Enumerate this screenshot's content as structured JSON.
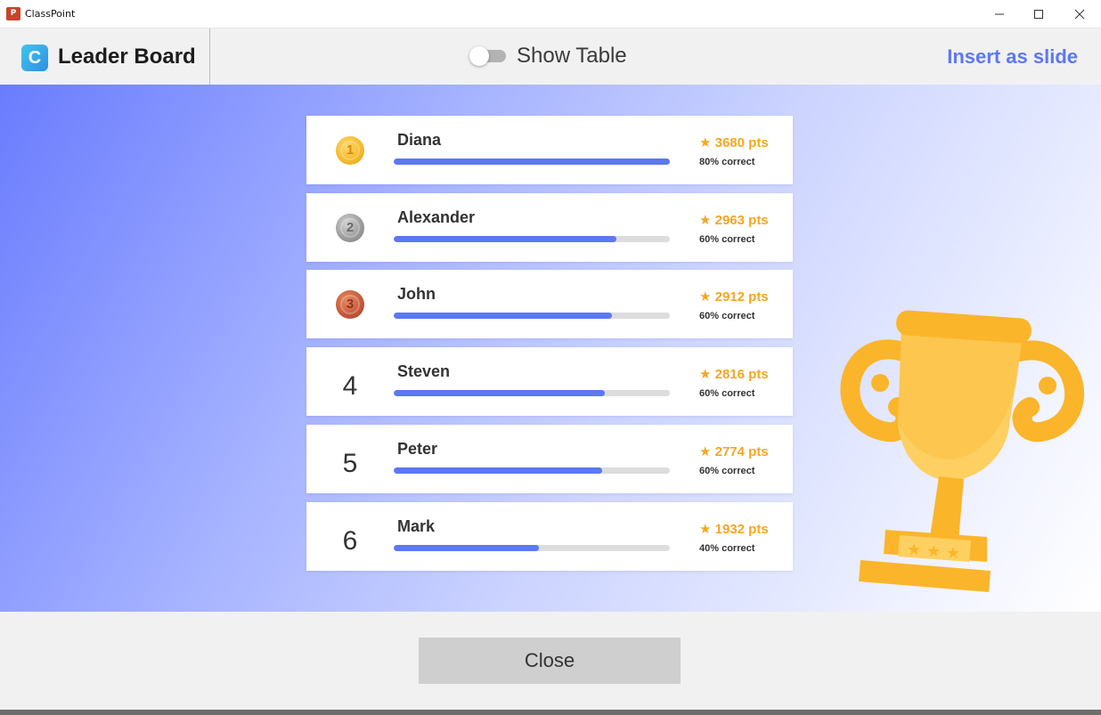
{
  "window": {
    "title": "ClassPoint",
    "app_icon_text": "P",
    "controls": {
      "minimize": "–",
      "maximize": "☐",
      "close": "✕"
    }
  },
  "header": {
    "logo_letter": "C",
    "title": "Leader Board",
    "toggle": {
      "label": "Show Table",
      "on": false
    },
    "insert_label": "Insert as slide"
  },
  "leaderboard": [
    {
      "rank": "1",
      "medal": "gold",
      "name": "Diana",
      "score": "★ 3680 pts",
      "correct": "80% correct",
      "progress": 1.0
    },
    {
      "rank": "2",
      "medal": "silver",
      "name": "Alexander",
      "score": "★ 2963 pts",
      "correct": "60% correct",
      "progress": 0.805
    },
    {
      "rank": "3",
      "medal": "bronze",
      "name": "John",
      "score": "★ 2912 pts",
      "correct": "60% correct",
      "progress": 0.791
    },
    {
      "rank": "4",
      "medal": null,
      "name": "Steven",
      "score": "★ 2816 pts",
      "correct": "60% correct",
      "progress": 0.765
    },
    {
      "rank": "5",
      "medal": null,
      "name": "Peter",
      "score": "★ 2774 pts",
      "correct": "60% correct",
      "progress": 0.754
    },
    {
      "rank": "6",
      "medal": null,
      "name": "Mark",
      "score": "★ 1932 pts",
      "correct": "40% correct",
      "progress": 0.525
    }
  ],
  "footer": {
    "close_label": "Close"
  },
  "colors": {
    "accent": "#5b78f5",
    "bar": "#5c78f2",
    "score": "#f5a623",
    "trophy": "#fbb52b",
    "trophy_light": "#fdd061"
  },
  "icons": {
    "trophy": "trophy-icon",
    "star": "star-icon"
  }
}
